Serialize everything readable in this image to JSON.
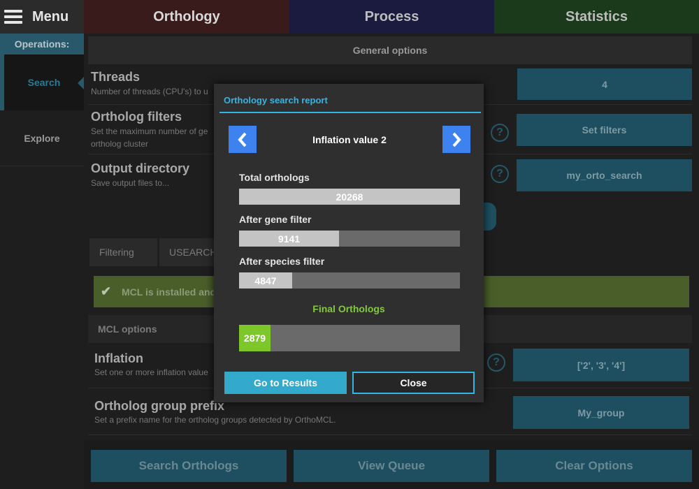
{
  "top_bar": {
    "menu_label": "Menu",
    "tabs": [
      {
        "label": "Orthology",
        "color": "#3a1b1b"
      },
      {
        "label": "Process",
        "color": "#1b1b3f"
      },
      {
        "label": "Statistics",
        "color": "#1b3a1b"
      }
    ]
  },
  "sidebar": {
    "section_label": "Operations:",
    "items": [
      {
        "label": "Search",
        "selected": true
      },
      {
        "label": "Explore",
        "selected": false
      }
    ]
  },
  "main": {
    "general_header": "General options",
    "threads": {
      "title": "Threads",
      "desc": "Number of threads (CPU's) to u",
      "value": "4"
    },
    "ortholog_filters": {
      "title": "Ortholog filters",
      "desc": "Set the maximum number of ge",
      "desc2": "ortholog cluster",
      "button": "Set filters"
    },
    "output_dir": {
      "title": "Output directory",
      "desc": "Save output files to...",
      "button": "my_orto_search"
    },
    "subtabs": [
      "Filtering",
      "USEARCH"
    ],
    "mcl_banner": "MCL is installed and",
    "mcl_header": "MCL options",
    "inflation": {
      "title": "Inflation",
      "desc": "Set one or more inflation value",
      "button": "['2', '3', '4']"
    },
    "group_prefix": {
      "title": "Ortholog group prefix",
      "desc": "Set a prefix name for the ortholog groups detected by OrthoMCL.",
      "button": "My_group"
    },
    "help_glyph": "?"
  },
  "bottom": {
    "search": "Search Orthologs",
    "queue": "View Queue",
    "clear": "Clear Options"
  },
  "modal": {
    "title": "Orthology search report",
    "inflation_label": "Inflation value 2",
    "prev_icon": "‹",
    "next_icon": "›",
    "stats": {
      "total": {
        "label": "Total orthologs",
        "value": "20268",
        "fraction": 1.0
      },
      "gene": {
        "label": "After gene filter",
        "value": "9141",
        "fraction": 0.451
      },
      "species": {
        "label": "After species filter",
        "value": "4847",
        "fraction": 0.239
      },
      "final": {
        "label": "Final Orthologs",
        "value": "2879",
        "fraction": 0.142
      }
    },
    "results_button": "Go to Results",
    "close_button": "Close",
    "accent_color": "#33b5e5",
    "final_color": "#7dc72b"
  }
}
